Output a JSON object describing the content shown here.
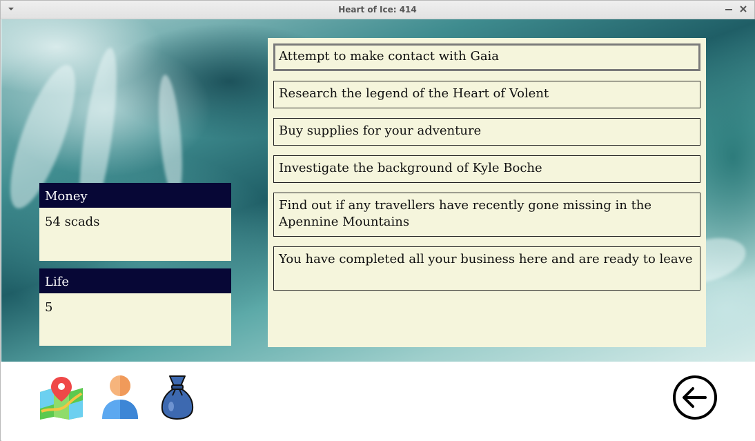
{
  "window": {
    "title": "Heart of Ice: 414"
  },
  "stats": [
    {
      "label": "Money",
      "value": "54 scads"
    },
    {
      "label": "Life",
      "value": "5"
    }
  ],
  "choices": [
    {
      "text": "Attempt to make contact with Gaia",
      "selected": true
    },
    {
      "text": "Research the legend of the Heart of Volent",
      "selected": false
    },
    {
      "text": "Buy supplies for your adventure",
      "selected": false
    },
    {
      "text": "Investigate the background of Kyle Boche",
      "selected": false
    },
    {
      "text": "Find out if any travellers have recently gone missing in the Apennine Mountains",
      "selected": false
    },
    {
      "text": "You have completed all your business here and are ready to leave",
      "selected": false
    }
  ],
  "toolbar": {
    "icons": [
      "map-icon",
      "character-icon",
      "inventory-bag-icon",
      "back-arrow-icon"
    ]
  },
  "colors": {
    "panel_bg": "#f5f5dc",
    "header_bg": "#070736",
    "map_green": "#5cc94f",
    "pin_red": "#ef4848",
    "person_orange": "#f6b47c",
    "person_blue": "#5ca8f0",
    "bag_blue": "#3d69b0"
  }
}
